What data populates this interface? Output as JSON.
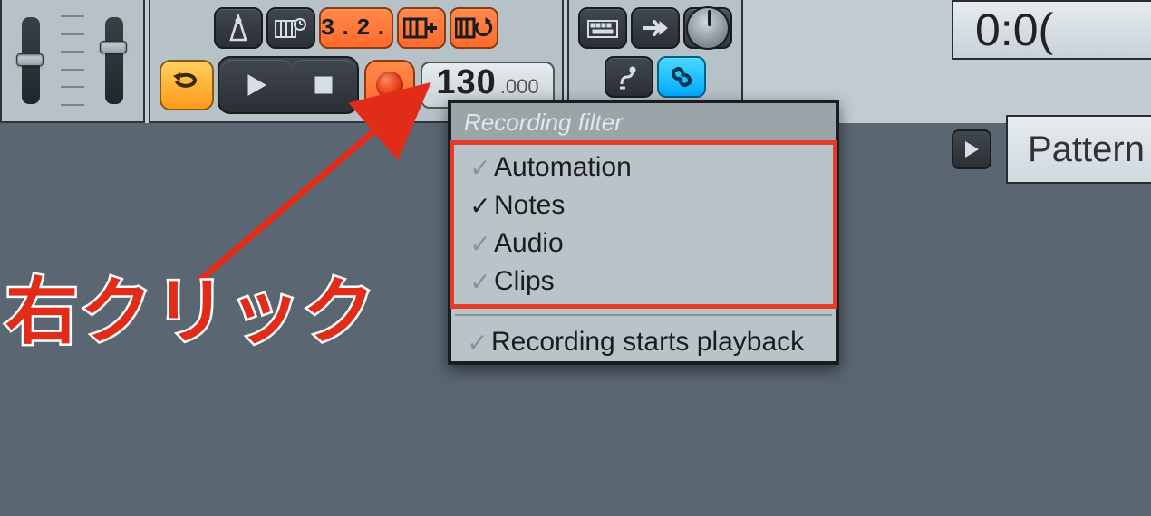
{
  "toolbar": {
    "metronome": "metronome-icon",
    "waitInput": "piano-clock-icon",
    "countdown": "3.2.",
    "blend": "piano-plus-icon",
    "loopRec": "piano-loop-icon",
    "typingKbd": "typing-keyboard-icon",
    "stepEdit": "arrow-right-icon",
    "knobPanel": "main-knob",
    "step": "step-icon",
    "link": "link-icon",
    "loop": "loop-icon",
    "play": "play-icon",
    "stop": "stop-icon",
    "record": "record-icon"
  },
  "bpm": {
    "int": "130",
    "frac": ".000"
  },
  "timeDisplay": "0:0(",
  "patternPlay": "play-icon",
  "patternLabel": "Pattern",
  "menu": {
    "title": "Recording filter",
    "items": [
      {
        "label": "Automation",
        "checked": false
      },
      {
        "label": "Notes",
        "checked": true
      },
      {
        "label": "Audio",
        "checked": false
      },
      {
        "label": "Clips",
        "checked": false
      }
    ],
    "footer": {
      "label": "Recording starts playback",
      "checked": false
    }
  },
  "annotation": "右クリック"
}
